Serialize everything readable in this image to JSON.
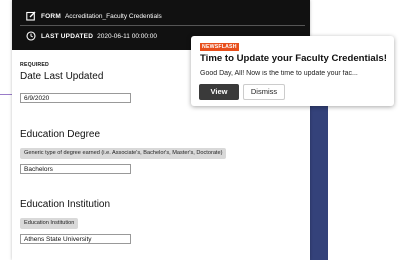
{
  "header": {
    "form_label": "FORM",
    "form_name": "Accreditation_Faculty Credentials",
    "updated_label": "LAST UPDATED",
    "updated_value": "2020-06-11 00:00:00"
  },
  "form": {
    "required_label": "REQUIRED",
    "date_title": "Date Last Updated",
    "date_value": "6/9/2020",
    "degree_title": "Education Degree",
    "degree_hint": "Generic type of degree earned (i.e. Associate's, Bachelor's, Master's, Doctorate)",
    "degree_value": "Bachelors",
    "institution_title": "Education Institution",
    "institution_hint": "Education Institution",
    "institution_value": "Athens State University"
  },
  "toast": {
    "badge": "NEWSFLASH",
    "title": "Time to Update your Faculty Credentials!",
    "body": "Good Day, All!  Now is the time to update your fac...",
    "view_label": "View",
    "dismiss_label": "Dismiss"
  },
  "colors": {
    "header_bg": "#111111",
    "badge": "#e84e1b",
    "accent_strip": "#34427a",
    "view_button": "#3a3a3a"
  },
  "icons": [
    "form-icon",
    "clock-icon"
  ]
}
